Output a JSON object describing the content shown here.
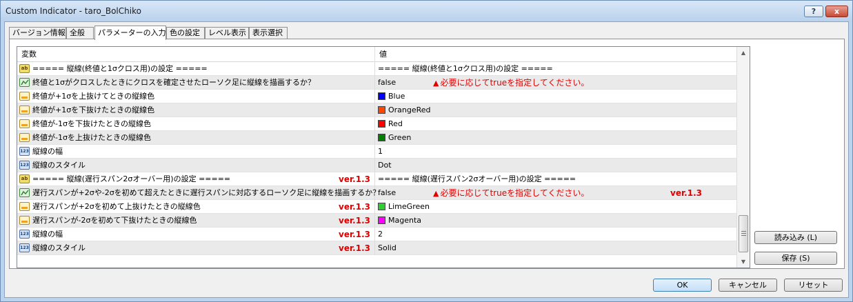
{
  "window": {
    "title": "Custom Indicator - taro_BolChiko",
    "help_label": "?",
    "close_label": "x"
  },
  "tabs": [
    {
      "label": "バージョン情報",
      "active": false
    },
    {
      "label": "全般",
      "active": false
    },
    {
      "label": "パラメーターの入力",
      "active": true
    },
    {
      "label": "色の設定",
      "active": false
    },
    {
      "label": "レベル表示",
      "active": false
    },
    {
      "label": "表示選択",
      "active": false
    }
  ],
  "grid": {
    "header": {
      "name": "変数",
      "value": "値"
    },
    "rows": [
      {
        "icon": "string-type-icon",
        "icon_text": "ab",
        "name": "===== 縦線(終値と1σクロス用)の設定 =====",
        "value": "===== 縦線(終値と1σクロス用)の設定 ====="
      },
      {
        "icon": "bool-type-icon",
        "name": "終値と1σがクロスしたときにクロスを確定させたローソク足に縦線を描画するか？",
        "value": "false",
        "note": "必要に応じてtrueを指定してください。",
        "note_mark": "▲"
      },
      {
        "icon": "color-type-icon",
        "name": "終値が+1σを上抜けてときの縦線色",
        "value": "Blue",
        "swatch": "#0000ff"
      },
      {
        "icon": "color-type-icon",
        "name": "終値が+1σを下抜けたときの縦線色",
        "value": "OrangeRed",
        "swatch": "#ff4500"
      },
      {
        "icon": "color-type-icon",
        "name": "終値が-1σを下抜けたときの縦線色",
        "value": "Red",
        "swatch": "#ff0000"
      },
      {
        "icon": "color-type-icon",
        "name": "終値が-1σを上抜けたときの縦線色",
        "value": "Green",
        "swatch": "#008000"
      },
      {
        "icon": "number-type-icon",
        "icon_text": "123",
        "name": "縦線の幅",
        "value": "1"
      },
      {
        "icon": "number-type-icon",
        "icon_text": "123",
        "name": "縦線のスタイル",
        "value": "Dot"
      },
      {
        "icon": "string-type-icon",
        "icon_text": "ab",
        "name": "===== 縦線(遅行スパン2σオーバー用)の設定 =====",
        "value": "===== 縦線(遅行スパン2σオーバー用)の設定 =====",
        "name_ver": "ver.1.3"
      },
      {
        "icon": "bool-type-icon",
        "name": "遅行スパンが+2σや-2σを初めて超えたときに遅行スパンに対応するローソク足に縦線を描画するか？",
        "value": "false",
        "note": "必要に応じてtrueを指定してください。",
        "note_mark": "▲",
        "value_ver": "ver.1.3"
      },
      {
        "icon": "color-type-icon",
        "name": "遅行スパンが+2σを初めて上抜けたときの縦線色",
        "value": "LimeGreen",
        "swatch": "#32cd32",
        "name_ver": "ver.1.3"
      },
      {
        "icon": "color-type-icon",
        "name": "遅行スパンが-2σを初めて下抜けたときの縦線色",
        "value": "Magenta",
        "swatch": "#ff00ff",
        "name_ver": "ver.1.3"
      },
      {
        "icon": "number-type-icon",
        "icon_text": "123",
        "name": "縦線の幅",
        "value": "2",
        "name_ver": "ver.1.3"
      },
      {
        "icon": "number-type-icon",
        "icon_text": "123",
        "name": "縦線のスタイル",
        "value": "Solid",
        "name_ver": "ver.1.3"
      }
    ]
  },
  "buttons": {
    "load": "読み込み (L)",
    "save": "保存 (S)",
    "ok": "OK",
    "cancel": "キャンセル",
    "reset": "リセット"
  },
  "colors": {
    "annotation": "#e00000",
    "selected_tab": "#ffffff",
    "titlebar": "#bcd3ec"
  }
}
